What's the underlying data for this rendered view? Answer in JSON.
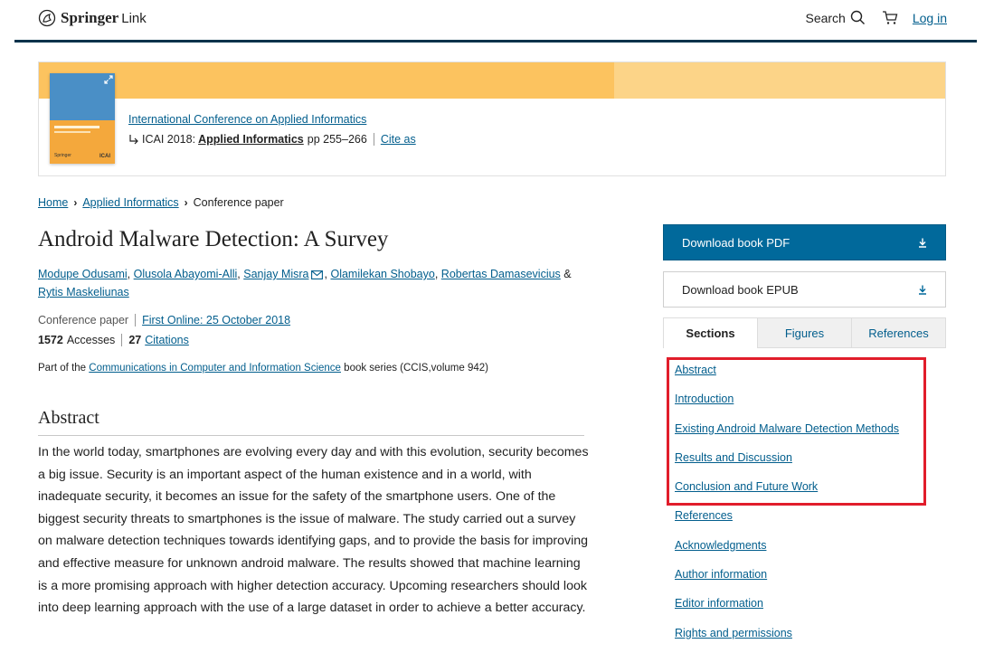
{
  "header": {
    "logo_word1": "Springer",
    "logo_word2": "Link",
    "search_label": "Search",
    "login_label": "Log in"
  },
  "book": {
    "conference_link": "International Conference on Applied Informatics",
    "event_prefix": "ICAI 2018:",
    "book_title": "Applied Informatics",
    "pages": "pp 255–266",
    "cite_label": "Cite as",
    "cover_logo_left": "Springer",
    "cover_logo_right": "ICAI"
  },
  "breadcrumb": {
    "home": "Home",
    "book": "Applied Informatics",
    "current": "Conference paper"
  },
  "article": {
    "title": "Android Malware Detection: A Survey",
    "authors": [
      "Modupe Odusami",
      "Olusola Abayomi-Alli",
      "Sanjay Misra",
      "Olamilekan Shobayo",
      "Robertas Damasevicius",
      "Rytis Maskeliunas"
    ],
    "author_sep": ",",
    "author_amp": "&",
    "type": "Conference paper",
    "first_online": "First Online: 25 October 2018",
    "accesses_count": "1572",
    "accesses_label": "Accesses",
    "citations_count": "27",
    "citations_label": "Citations",
    "partof_prefix": "Part of the",
    "partof_series": "Communications in Computer and Information Science",
    "partof_suffix": "book series (CCIS,volume 942)",
    "abstract_heading": "Abstract",
    "abstract_text": "In the world today, smartphones are evolving every day and with this evolution, security becomes a big issue. Security is an important aspect of the human existence and in a world, with inadequate security, it becomes an issue for the safety of the smartphone users. One of the biggest security threats to smartphones is the issue of malware. The study carried out a survey on malware detection techniques towards identifying gaps, and to provide the basis for improving and effective measure for unknown android malware. The results showed that machine learning is a more promising approach with higher detection accuracy. Upcoming researchers should look into deep learning approach with the use of a large dataset in order to achieve a better accuracy."
  },
  "sidebar": {
    "download_pdf": "Download book PDF",
    "download_epub": "Download book EPUB",
    "tabs": [
      "Sections",
      "Figures",
      "References"
    ],
    "active_tab": "Sections",
    "sections": [
      "Abstract",
      "Introduction",
      "Existing Android Malware Detection Methods",
      "Results and Discussion",
      "Conclusion and Future Work",
      "References",
      "Acknowledgments",
      "Author information",
      "Editor information",
      "Rights and permissions"
    ]
  },
  "colors": {
    "brand_blue": "#01699b",
    "link": "#025e8d",
    "header_rule": "#01324b",
    "banner_orange": "#fcc35f",
    "highlight_red": "#e11d2b"
  }
}
